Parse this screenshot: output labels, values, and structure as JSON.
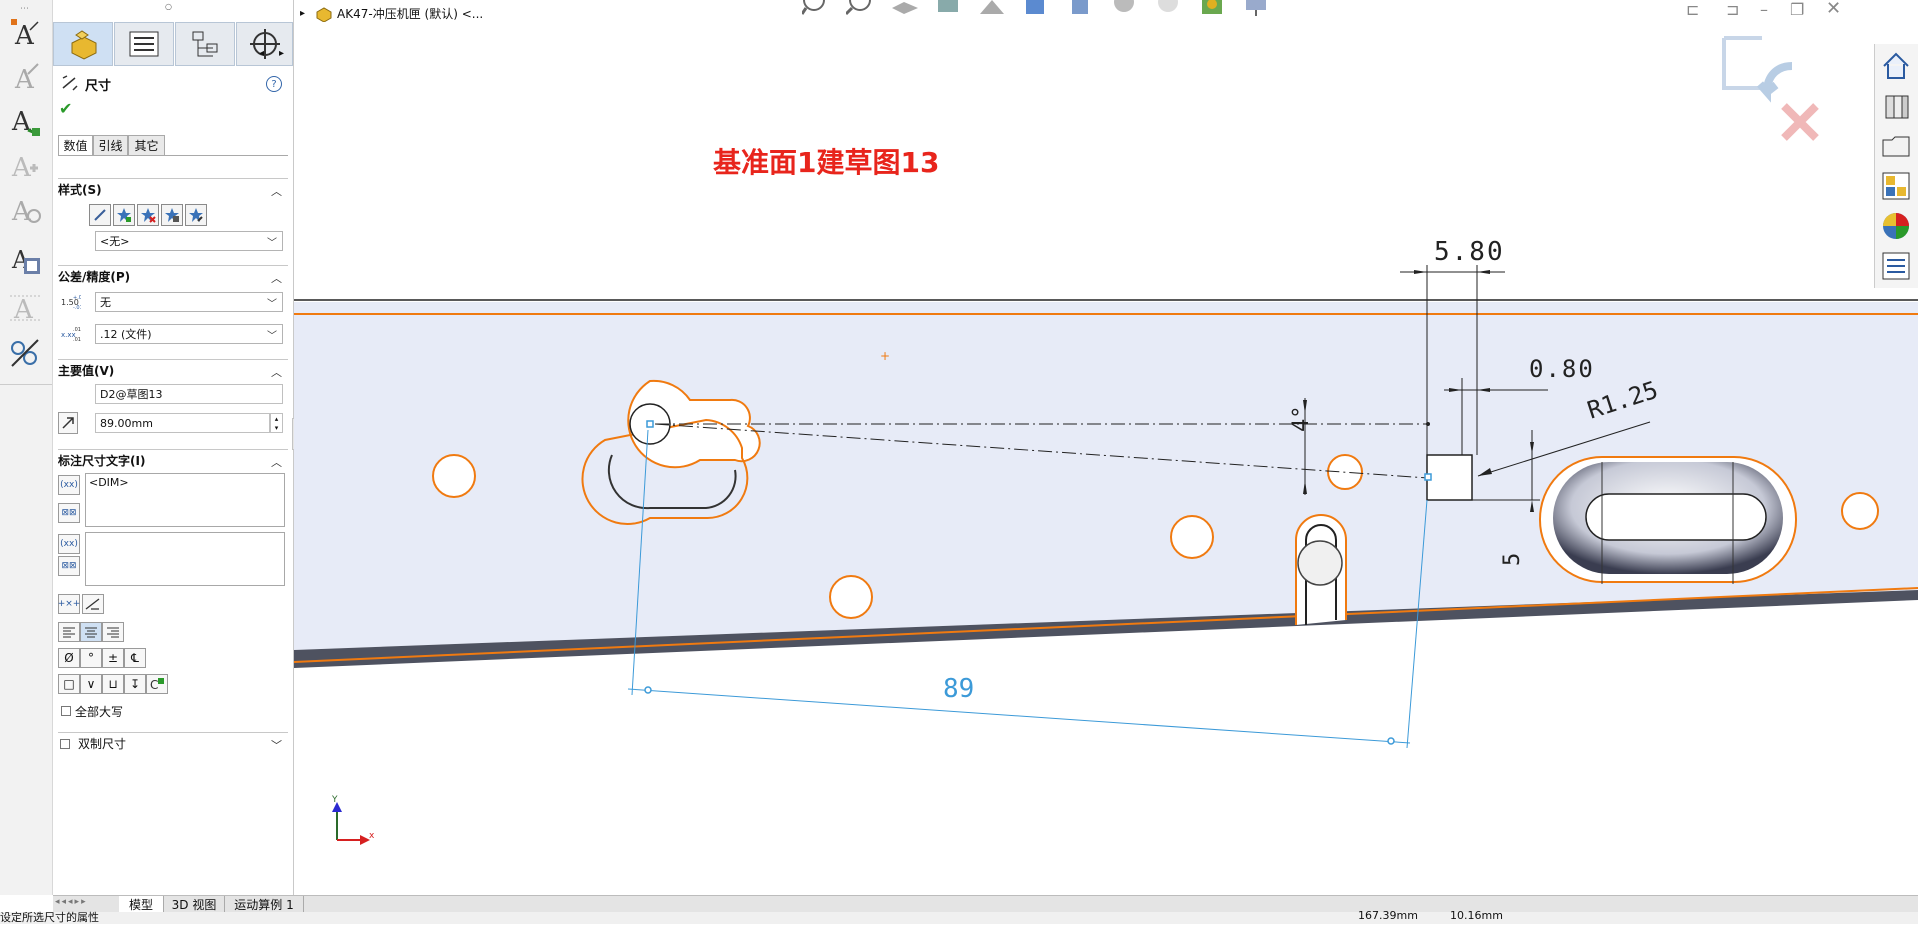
{
  "window": {
    "document_title": "AK47-冲压机匣 (默认) <...",
    "menu_chevron": "▸"
  },
  "property_manager": {
    "title": "尺寸",
    "help": "?",
    "ok_mark": "✔",
    "subtabs": [
      {
        "label": "数值",
        "active": true
      },
      {
        "label": "引线",
        "active": false
      },
      {
        "label": "其它",
        "active": false
      }
    ],
    "style_section": {
      "title": "样式(S)",
      "style_dropdown": "<无>"
    },
    "tolerance_section": {
      "title": "公差/精度(P)",
      "tolerance_type": "无",
      "precision": ".12 (文件)"
    },
    "primary_section": {
      "title": "主要值(V)",
      "dimension_name": "D2@草图13",
      "dimension_value": "89.00mm"
    },
    "dim_text_section": {
      "title": "标注尺寸文字(I)",
      "top_text": "<DIM>",
      "bottom_text": ""
    },
    "all_caps_label": "全部大写",
    "dual_dim_label": "双制尺寸"
  },
  "bottom_tabs": [
    {
      "label": "模型",
      "active": true
    },
    {
      "label": "3D 视图",
      "active": false
    },
    {
      "label": "运动算例 1",
      "active": false
    }
  ],
  "status_bar": {
    "hint": "设定所选尺寸的属性",
    "x_coord": "167.39mm",
    "y_coord": "10.16mm"
  },
  "canvas": {
    "annotation": "基准面1建草图13",
    "dimensions": {
      "d1": "5.80",
      "d2": "0.80",
      "radius": "R1.25",
      "angle": "4°",
      "d3": "5",
      "length": "89"
    },
    "triad": {
      "x": "x",
      "y": "Y"
    }
  },
  "colors": {
    "accent_red": "#e8251c",
    "sketch_orange": "#f07a10",
    "sketch_blue": "#3c9ad8",
    "part_fill": "#e7ebf7"
  },
  "icons": {
    "left_strip": [
      "smart-dimension-icon",
      "note-icon",
      "balloon-icon",
      "auto-balloon-icon",
      "surface-finish-icon",
      "weld-symbol-icon",
      "datum-feature-icon",
      "geometric-tolerance-icon"
    ],
    "pm_tabs": [
      "feature-manager-icon",
      "property-manager-icon",
      "configuration-manager-icon",
      "dim-xpert-icon"
    ],
    "right_taskpane": [
      "home-icon",
      "design-library-icon",
      "file-explorer-icon",
      "view-palette-icon",
      "appearances-icon",
      "custom-properties-icon"
    ]
  }
}
